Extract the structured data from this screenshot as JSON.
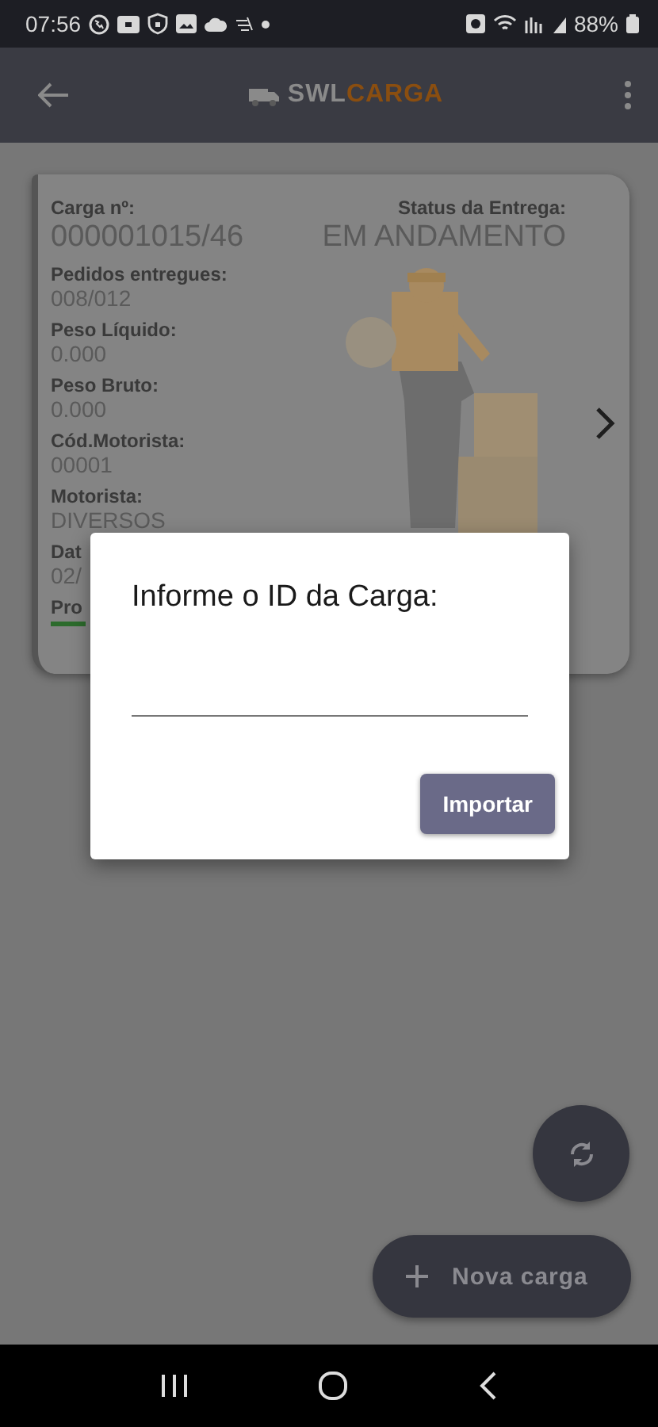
{
  "status_bar": {
    "time": "07:56",
    "battery": "88%"
  },
  "app_bar": {
    "logo_brand": "SWL",
    "logo_product": "CARGA"
  },
  "load_card": {
    "fields": [
      {
        "label": "Carga nº:",
        "value": "000001015/46",
        "kind": "large"
      },
      {
        "label": "Pedidos entregues:",
        "value": "008/012",
        "kind": "normal"
      },
      {
        "label": "Peso Líquido:",
        "value": "0.000",
        "kind": "normal"
      },
      {
        "label": "Peso Bruto:",
        "value": "0.000",
        "kind": "normal"
      },
      {
        "label": "Cód.Motorista:",
        "value": "00001",
        "kind": "normal"
      },
      {
        "label": "Motorista:",
        "value": "DIVERSOS",
        "kind": "normal"
      },
      {
        "label": "Dat",
        "value": "02/",
        "kind": "normal"
      },
      {
        "label": "Pro",
        "kind": "progress",
        "level": 1
      }
    ],
    "status_label": "Status da Entrega:",
    "status_value": "EM ANDAMENTO"
  },
  "dialog": {
    "title": "Informe o ID da Carga:",
    "button": "Importar"
  },
  "fab": {
    "label": "Nova carga"
  }
}
